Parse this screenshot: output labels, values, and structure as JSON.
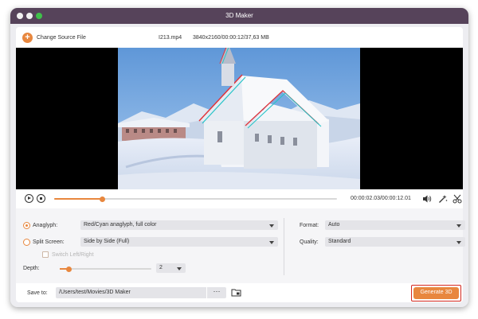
{
  "window": {
    "title": "3D Maker"
  },
  "source": {
    "change_label": "Change Source File",
    "file_name": "I213.mp4",
    "file_info": "3840x2160/00:00:12/37,63 MB"
  },
  "player": {
    "time": "00:00:02.03/00:00:12.01",
    "progress": 0.17
  },
  "settings": {
    "anaglyph": {
      "label": "Anaglyph:",
      "value": "Red/Cyan anaglyph, full color",
      "selected": true
    },
    "split": {
      "label": "Split Screen:",
      "value": "Side by Side (Full)",
      "selected": false
    },
    "switch_label": "Switch Left/Right",
    "depth": {
      "label": "Depth:",
      "value": "2",
      "fraction": 0.1
    },
    "format": {
      "label": "Format:",
      "value": "Auto"
    },
    "quality": {
      "label": "Quality:",
      "value": "Standard"
    }
  },
  "save": {
    "label": "Save to:",
    "path": "/Users/test/Movies/3D Maker",
    "browse_label": "···"
  },
  "generate_label": "Generate 3D",
  "colors": {
    "accent": "#e8873e",
    "titlebar": "#56435a",
    "highlight": "#d4281f"
  }
}
